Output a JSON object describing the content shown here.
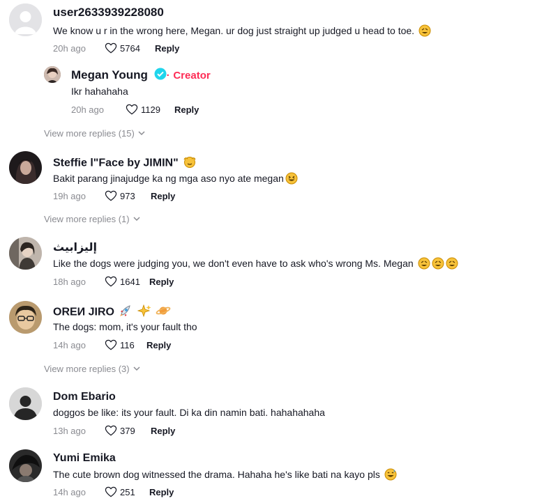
{
  "comments": [
    {
      "username": "user2633939228080",
      "text": "We know u r in the wrong here, Megan. ur dog just straight up judged u head to toe.",
      "time": "20h ago",
      "likes": "5764",
      "reply_label": "Reply",
      "reply": {
        "username": "Megan Young",
        "badge": "Creator",
        "text": "Ikr hahahaha",
        "time": "20h ago",
        "likes": "1129",
        "reply_label": "Reply"
      },
      "view_more": "View more replies (15)"
    },
    {
      "username": "Steffie l\"Face by JIMIN\"",
      "text": "Bakit parang jinajudge ka ng mga aso nyo ate megan",
      "time": "19h ago",
      "likes": "973",
      "reply_label": "Reply",
      "view_more": "View more replies (1)"
    },
    {
      "username": "إليزابيث",
      "text": "Like the dogs were judging you, we don't even have to ask who's wrong Ms. Megan",
      "time": "18h ago",
      "likes": "1641",
      "reply_label": "Reply"
    },
    {
      "username": "OREИ JIRO",
      "text": "The dogs: mom, it's your fault tho",
      "time": "14h ago",
      "likes": "116",
      "reply_label": "Reply",
      "view_more": "View more replies (3)"
    },
    {
      "username": "Dom Ebario",
      "text": "doggos be like: its your fault. Di ka din namin bati. hahahahaha",
      "time": "13h ago",
      "likes": "379",
      "reply_label": "Reply"
    },
    {
      "username": "Yumi Emika",
      "text": "The cute brown dog witnessed the drama. Hahaha he's like bati na kayo pls",
      "time": "14h ago",
      "likes": "251",
      "reply_label": "Reply"
    }
  ],
  "colors": {
    "accent": "#fe2c55",
    "verified": "#20d5ec",
    "muted": "#8a8b91"
  }
}
